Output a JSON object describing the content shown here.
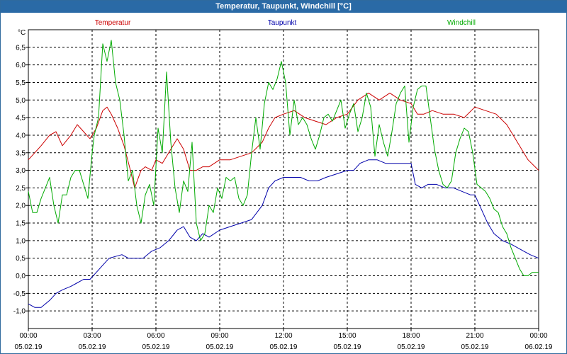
{
  "window": {
    "title": "Temperatur, Taupunkt, Windchill [°C]"
  },
  "chart_data": {
    "type": "line",
    "title": "Temperatur, Taupunkt, Windchill [°C]",
    "ylabel": "°C",
    "ylim": [
      -1.5,
      7.0
    ],
    "yticks": [
      -1.0,
      -0.5,
      0.0,
      0.5,
      1.0,
      1.5,
      2.0,
      2.5,
      3.0,
      3.5,
      4.0,
      4.5,
      5.0,
      5.5,
      6.0,
      6.5
    ],
    "ytick_labels": [
      "-1,0",
      "-0,5",
      "0,0",
      "0,5",
      "1,0",
      "1,5",
      "2,0",
      "2,5",
      "3,0",
      "3,5",
      "4,0",
      "4,5",
      "5,0",
      "5,5",
      "6,0",
      "6,5"
    ],
    "xlim": [
      0,
      24
    ],
    "xticks": [
      0,
      3,
      6,
      9,
      12,
      15,
      18,
      21,
      24
    ],
    "xtick_time_labels": [
      "00:00",
      "03:00",
      "06:00",
      "09:00",
      "12:00",
      "15:00",
      "18:00",
      "21:00",
      "00:00"
    ],
    "xtick_date_labels": [
      "05.02.19",
      "05.02.19",
      "05.02.19",
      "05.02.19",
      "05.02.19",
      "05.02.19",
      "05.02.19",
      "05.02.19",
      "06.02.19"
    ],
    "grid": true,
    "legend_position": "top",
    "series": [
      {
        "name": "Temperatur",
        "color": "#cc0000",
        "x": [
          0,
          0.3,
          0.6,
          1.0,
          1.3,
          1.6,
          2.0,
          2.3,
          2.6,
          2.9,
          3.2,
          3.5,
          3.7,
          3.9,
          4.2,
          4.5,
          4.8,
          5.0,
          5.3,
          5.5,
          5.8,
          6.0,
          6.3,
          6.6,
          7.0,
          7.3,
          7.6,
          7.9,
          8.2,
          8.5,
          9.0,
          9.5,
          10.0,
          10.5,
          11.0,
          11.3,
          11.6,
          12.0,
          12.5,
          13.0,
          13.5,
          14.0,
          14.5,
          15.0,
          15.5,
          16.0,
          16.5,
          17.0,
          17.5,
          18.0,
          18.3,
          18.6,
          19.0,
          19.5,
          20.0,
          20.5,
          21.0,
          21.5,
          22.0,
          22.5,
          23.0,
          23.5,
          24.0
        ],
        "y": [
          3.3,
          3.5,
          3.7,
          4.0,
          4.1,
          3.7,
          4.0,
          4.3,
          4.1,
          3.9,
          4.2,
          4.7,
          4.8,
          4.6,
          4.2,
          3.7,
          3.0,
          2.5,
          3.0,
          3.1,
          3.0,
          3.3,
          3.2,
          3.5,
          3.9,
          3.6,
          3.0,
          3.0,
          3.1,
          3.1,
          3.3,
          3.3,
          3.4,
          3.5,
          3.8,
          4.2,
          4.5,
          4.6,
          4.7,
          4.5,
          4.4,
          4.3,
          4.5,
          4.6,
          5.0,
          5.2,
          5.0,
          5.2,
          5.0,
          4.9,
          4.6,
          4.6,
          4.7,
          4.6,
          4.6,
          4.5,
          4.8,
          4.7,
          4.6,
          4.3,
          3.8,
          3.3,
          3.0
        ]
      },
      {
        "name": "Taupunkt",
        "color": "#0000aa",
        "x": [
          0,
          0.3,
          0.6,
          1.0,
          1.3,
          1.6,
          2.0,
          2.3,
          2.6,
          2.9,
          3.2,
          3.5,
          3.8,
          4.1,
          4.4,
          4.7,
          5.0,
          5.4,
          5.8,
          6.2,
          6.6,
          7.0,
          7.3,
          7.6,
          7.9,
          8.2,
          8.5,
          9.0,
          9.5,
          10.0,
          10.5,
          11.0,
          11.3,
          11.6,
          12.0,
          12.4,
          12.8,
          13.2,
          13.6,
          14.0,
          14.5,
          15.0,
          15.3,
          15.6,
          16.0,
          16.4,
          16.8,
          17.2,
          17.6,
          18.0,
          18.2,
          18.5,
          18.8,
          19.2,
          19.6,
          20.0,
          20.4,
          20.8,
          21.0,
          21.3,
          21.6,
          21.9,
          22.3,
          22.7,
          23.0,
          23.3,
          23.6,
          24.0
        ],
        "y": [
          -0.8,
          -0.9,
          -0.9,
          -0.7,
          -0.5,
          -0.4,
          -0.3,
          -0.2,
          -0.1,
          -0.1,
          0.1,
          0.3,
          0.5,
          0.55,
          0.6,
          0.5,
          0.5,
          0.5,
          0.7,
          0.8,
          1.0,
          1.3,
          1.4,
          1.1,
          1.0,
          1.2,
          1.1,
          1.3,
          1.4,
          1.5,
          1.6,
          2.0,
          2.5,
          2.7,
          2.8,
          2.8,
          2.8,
          2.7,
          2.7,
          2.8,
          2.9,
          3.0,
          3.0,
          3.2,
          3.3,
          3.3,
          3.2,
          3.2,
          3.2,
          3.2,
          2.6,
          2.5,
          2.6,
          2.6,
          2.5,
          2.5,
          2.4,
          2.3,
          2.3,
          1.9,
          1.5,
          1.2,
          1.0,
          0.9,
          0.8,
          0.7,
          0.6,
          0.5
        ]
      },
      {
        "name": "Windchill",
        "color": "#00aa00",
        "x": [
          0,
          0.2,
          0.4,
          0.6,
          0.8,
          1.0,
          1.2,
          1.4,
          1.6,
          1.8,
          2.0,
          2.2,
          2.4,
          2.6,
          2.8,
          3.0,
          3.1,
          3.3,
          3.5,
          3.7,
          3.9,
          4.1,
          4.3,
          4.5,
          4.7,
          4.9,
          5.1,
          5.3,
          5.5,
          5.7,
          5.9,
          6.1,
          6.3,
          6.5,
          6.7,
          6.9,
          7.1,
          7.3,
          7.5,
          7.7,
          7.9,
          8.1,
          8.3,
          8.5,
          8.7,
          8.9,
          9.1,
          9.3,
          9.5,
          9.7,
          9.9,
          10.1,
          10.3,
          10.5,
          10.7,
          10.9,
          11.1,
          11.3,
          11.5,
          11.7,
          11.9,
          12.1,
          12.3,
          12.5,
          12.7,
          12.9,
          13.1,
          13.3,
          13.5,
          13.7,
          13.9,
          14.1,
          14.3,
          14.5,
          14.7,
          14.9,
          15.1,
          15.3,
          15.5,
          15.7,
          15.9,
          16.1,
          16.3,
          16.5,
          16.7,
          16.9,
          17.1,
          17.3,
          17.5,
          17.7,
          17.9,
          18.1,
          18.3,
          18.5,
          18.7,
          18.9,
          19.1,
          19.3,
          19.5,
          19.7,
          19.9,
          20.1,
          20.3,
          20.5,
          20.7,
          20.9,
          21.1,
          21.3,
          21.5,
          21.7,
          21.9,
          22.1,
          22.3,
          22.5,
          22.7,
          22.9,
          23.1,
          23.3,
          23.5,
          23.7,
          23.9,
          24.0
        ],
        "y": [
          2.4,
          1.8,
          1.8,
          2.2,
          2.5,
          2.8,
          2.0,
          1.5,
          2.3,
          2.3,
          2.8,
          3.0,
          3.0,
          2.6,
          2.2,
          3.5,
          4.0,
          4.5,
          6.6,
          6.1,
          6.7,
          5.5,
          5.0,
          4.0,
          2.7,
          3.0,
          2.0,
          1.5,
          2.3,
          2.6,
          2.0,
          4.2,
          3.5,
          5.8,
          3.8,
          2.5,
          1.8,
          2.7,
          2.4,
          3.8,
          1.5,
          1.0,
          1.2,
          2.0,
          1.8,
          2.5,
          2.2,
          2.8,
          2.7,
          2.8,
          2.2,
          2.0,
          2.3,
          3.5,
          4.5,
          3.6,
          4.9,
          5.5,
          5.3,
          5.6,
          6.1,
          5.5,
          4.0,
          5.0,
          4.3,
          4.5,
          4.3,
          3.9,
          3.6,
          4.0,
          4.5,
          4.6,
          4.4,
          4.7,
          5.0,
          4.2,
          4.6,
          4.9,
          4.1,
          4.5,
          5.2,
          4.8,
          3.4,
          4.3,
          3.8,
          3.4,
          4.1,
          4.9,
          5.2,
          5.4,
          3.8,
          4.8,
          5.3,
          5.4,
          5.4,
          4.5,
          3.6,
          3.0,
          2.6,
          2.5,
          2.7,
          3.5,
          3.9,
          4.2,
          4.1,
          3.5,
          2.6,
          2.5,
          2.4,
          2.2,
          1.9,
          1.8,
          1.4,
          1.2,
          0.8,
          0.5,
          0.2,
          0.0,
          0.0,
          0.1,
          0.1,
          0.1
        ]
      }
    ]
  }
}
